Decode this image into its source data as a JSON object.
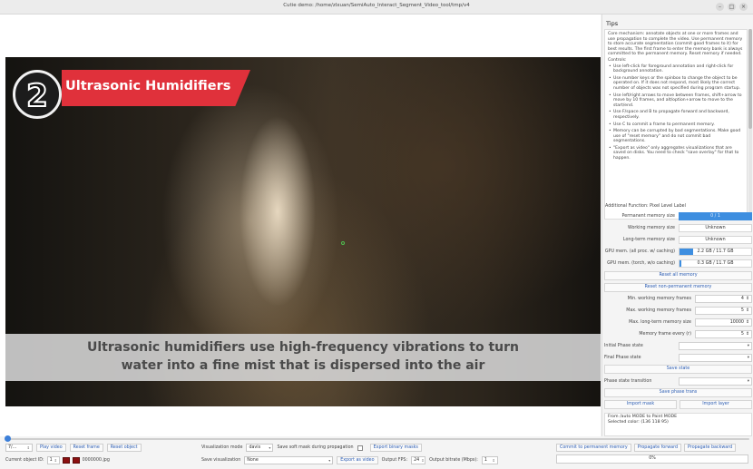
{
  "window": {
    "title": "Cutie demo: /home/zlxuan/SemiAuto_Interact_Segment_Video_tool/tmp/v4"
  },
  "video": {
    "badge_number": "2",
    "badge_title": "Ultrasonic Humidifiers",
    "caption_line1": "Ultrasonic humidifiers use high-frequency vibrations to turn",
    "caption_line2": "water into a fine mist that is dispersed into the air"
  },
  "timeline": {
    "progress": 0.0
  },
  "bottom": {
    "frame_counter": "7/...",
    "play_video": "Play video",
    "reset_frame": "Reset frame",
    "reset_object": "Reset object",
    "current_object_label": "Current object ID:",
    "current_object_value": "1",
    "frame_filename": "0000000.jpg",
    "vis_mode_label": "Visualization mode",
    "vis_mode_value": "davis",
    "save_soft_mask_label": "Save soft mask during propagation",
    "export_binary_masks": "Export binary masks",
    "save_vis_label": "Save visualization",
    "save_vis_value": "None",
    "export_as_video": "Export as video",
    "output_fps_label": "Output FPS:",
    "output_fps_value": "24",
    "output_bitrate_label": "Output bitrate (Mbps):",
    "output_bitrate_value": "1",
    "commit_btn": "Commit to permanent memory",
    "propagate_forward": "Propagate forward",
    "propagate_backward": "Propagate backward",
    "progress_text": "0%",
    "mask_color": "#8b1010"
  },
  "side": {
    "tips_title": "Tips",
    "tips_intro": "Core mechanism: annotate objects at one or more frames and use propagation to complete the video. Use permanent memory to store accurate segmentation (commit good frames to it) for best results. The first frame to enter the memory bank is always committed to the permanent memory. Reset memory if needed.",
    "controls_label": "Controls:",
    "tips": [
      "Use left-click for foreground annotation and right-click for background annotation.",
      "Use number keys or the spinbox to change the object to be operated on. If it does not respond, most likely the correct number of objects was not specified during program startup.",
      "Use left/right arrows to move between frames, shift+arrow to move by 10 frames, and alt/option+arrow to move to the start/end.",
      "Use F/space and B to propagate forward and backward, respectively.",
      "Use C to commit a frame to permanent memory.",
      "Memory can be corrupted by bad segmentations. Make good use of \"reset memory\" and do not commit bad segmentations.",
      "\"Export as video\" only aggregates visualizations that are saved on disks. You need to check \"save overlay\" for that to happen."
    ],
    "additional_function": "Additional Function: Pixel Level Label",
    "permanent_memory_label": "Permanent memory size",
    "permanent_memory_value": "0 / 1",
    "working_memory_label": "Working memory size",
    "working_memory_value": "Unknown",
    "long_term_memory_label": "Long-term memory size",
    "long_term_memory_value": "Unknown",
    "gpu_all_label": "GPU mem. (all proc. w/ caching)",
    "gpu_all_value": "2.2 GB / 11.7 GB",
    "gpu_all_level": 0.19,
    "gpu_torch_label": "GPU mem. (torch, w/o caching)",
    "gpu_torch_value": "0.3 GB / 11.7 GB",
    "gpu_torch_level": 0.03,
    "reset_all_memory": "Reset all memory",
    "reset_non_permanent": "Reset non-permanent memory",
    "min_working_label": "Min. working memory frames",
    "min_working_value": "4",
    "max_working_label": "Max. working memory frames",
    "max_working_value": "5",
    "max_long_term_label": "Max. long-term memory size",
    "max_long_term_value": "10000",
    "memory_every_label": "Memory frame every (r)",
    "memory_every_value": "5",
    "initial_phase_label": "Initial Phase state",
    "final_phase_label": "Final Phase state",
    "save_state": "Save state",
    "phase_transition_label": "Phase state transition",
    "save_phase_trans": "Save phase trans",
    "import_mask": "Import mask",
    "import_layer": "Import layer",
    "log_line1": "From /auto MODE to Paint MODE",
    "log_line2": "Selected color: (136 118  95)"
  }
}
